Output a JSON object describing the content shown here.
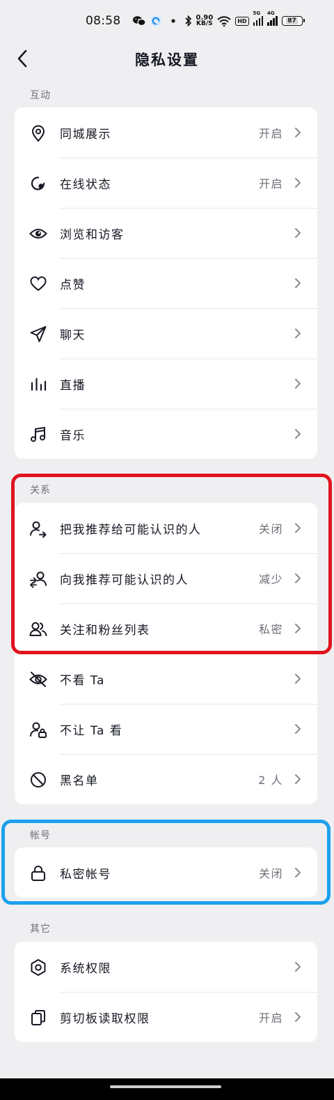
{
  "status_bar": {
    "time": "08:58",
    "net_speed_value": "0.90",
    "net_speed_unit": "KB/S",
    "hd_label": "HD",
    "sig1_label": "5G",
    "sig2_label": "4G",
    "battery": "87",
    "icons": [
      "wechat-icon",
      "app-icon",
      "dot-icon",
      "bluetooth-icon",
      "wifi-icon"
    ]
  },
  "header": {
    "title": "隐私设置"
  },
  "sections": [
    {
      "label": "互动",
      "items": [
        {
          "label": "同城展示",
          "value": "开启",
          "icon": "location-pin-icon"
        },
        {
          "label": "在线状态",
          "value": "开启",
          "icon": "online-status-icon"
        },
        {
          "label": "浏览和访客",
          "value": "",
          "icon": "eye-icon"
        },
        {
          "label": "点赞",
          "value": "",
          "icon": "heart-icon"
        },
        {
          "label": "聊天",
          "value": "",
          "icon": "paper-plane-icon"
        },
        {
          "label": "直播",
          "value": "",
          "icon": "bars-icon"
        },
        {
          "label": "音乐",
          "value": "",
          "icon": "music-note-icon"
        }
      ]
    },
    {
      "label": "关系",
      "items": [
        {
          "label": "把我推荐给可能认识的人",
          "value": "关闭",
          "icon": "user-share-icon"
        },
        {
          "label": "向我推荐可能认识的人",
          "value": "减少",
          "icon": "user-recommend-icon"
        },
        {
          "label": "关注和粉丝列表",
          "value": "私密",
          "icon": "users-icon"
        },
        {
          "label": "不看 Ta",
          "value": "",
          "icon": "eye-off-icon"
        },
        {
          "label": "不让 Ta 看",
          "value": "",
          "icon": "user-lock-icon"
        },
        {
          "label": "黑名单",
          "value": "2 人",
          "icon": "block-icon"
        }
      ]
    },
    {
      "label": "帐号",
      "items": [
        {
          "label": "私密帐号",
          "value": "关闭",
          "icon": "lock-icon"
        }
      ]
    },
    {
      "label": "其它",
      "items": [
        {
          "label": "系统权限",
          "value": "",
          "icon": "hexagon-settings-icon"
        },
        {
          "label": "剪切板读取权限",
          "value": "开启",
          "icon": "clipboard-icon"
        }
      ]
    }
  ],
  "colors": {
    "background": "#efeff1",
    "card": "#ffffff",
    "text_primary": "#161823",
    "text_secondary": "#6d6f78",
    "highlight_red": "#e0141e",
    "highlight_blue": "#1da1ee"
  }
}
